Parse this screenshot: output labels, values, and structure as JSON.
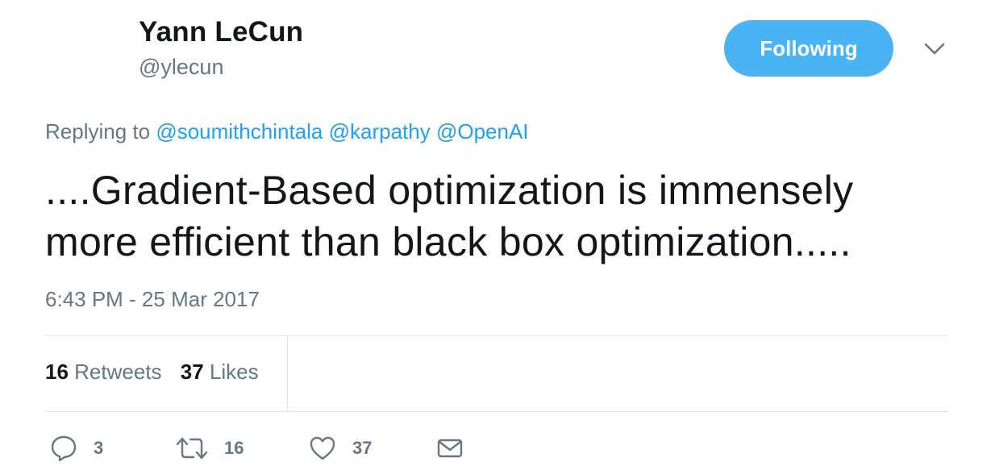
{
  "author": {
    "name": "Yann LeCun",
    "handle": "@ylecun"
  },
  "follow_button": {
    "label": "Following",
    "color": "#4ab3f4"
  },
  "menu": {
    "icon": "chevron-down-icon"
  },
  "reply": {
    "prefix": "Replying to",
    "mentions": [
      "@soumithchintala",
      "@karpathy",
      "@OpenAI"
    ]
  },
  "tweet": {
    "text": "....Gradient-Based optimization is immensely more efficient than black box optimization.....",
    "timestamp": "6:43 PM - 25 Mar 2017"
  },
  "stats": {
    "retweets_count": "16",
    "retweets_label": "Retweets",
    "likes_count": "37",
    "likes_label": "Likes"
  },
  "actions": {
    "reply": {
      "icon": "reply-icon",
      "count": "3"
    },
    "retweet": {
      "icon": "retweet-icon",
      "count": "16"
    },
    "like": {
      "icon": "heart-icon",
      "count": "37"
    },
    "message": {
      "icon": "envelope-icon"
    }
  },
  "colors": {
    "link": "#1da1f2",
    "secondary_text": "#657786",
    "primary_text": "#14171a",
    "divider": "#e1e8ed"
  }
}
